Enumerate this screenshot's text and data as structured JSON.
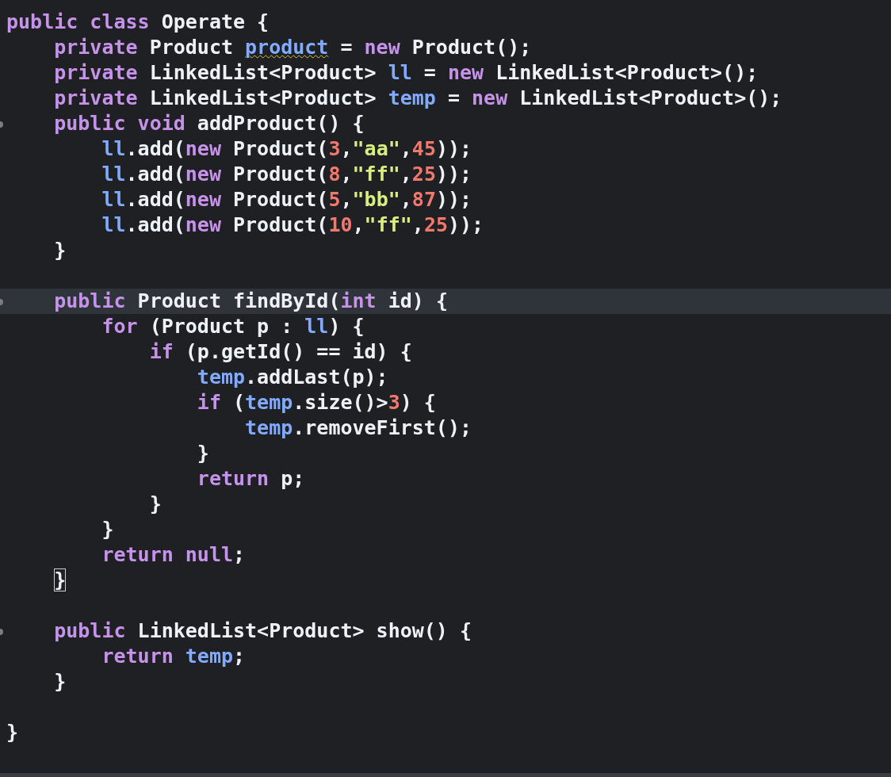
{
  "editor": {
    "lines": [
      {
        "foldable": false,
        "current": false,
        "tokens": [
          {
            "kind": "keyword",
            "text": "public"
          },
          {
            "kind": "keyword",
            "text": " class"
          },
          {
            "kind": "plain",
            "text": " Operate {"
          }
        ]
      },
      {
        "foldable": false,
        "current": false,
        "tokens": [
          {
            "kind": "keyword",
            "text": "    private"
          },
          {
            "kind": "plain",
            "text": " Product "
          },
          {
            "kind": "field_warned",
            "text": "product"
          },
          {
            "kind": "plain",
            "text": " = "
          },
          {
            "kind": "keyword",
            "text": "new"
          },
          {
            "kind": "plain",
            "text": " Product();"
          }
        ]
      },
      {
        "foldable": false,
        "current": false,
        "tokens": [
          {
            "kind": "keyword",
            "text": "    private"
          },
          {
            "kind": "plain",
            "text": " LinkedList<Product> "
          },
          {
            "kind": "field",
            "text": "ll"
          },
          {
            "kind": "plain",
            "text": " = "
          },
          {
            "kind": "keyword",
            "text": "new"
          },
          {
            "kind": "plain",
            "text": " LinkedList<Product>();"
          }
        ]
      },
      {
        "foldable": false,
        "current": false,
        "tokens": [
          {
            "kind": "keyword",
            "text": "    private"
          },
          {
            "kind": "plain",
            "text": " LinkedList<Product> "
          },
          {
            "kind": "field",
            "text": "temp"
          },
          {
            "kind": "plain",
            "text": " = "
          },
          {
            "kind": "keyword",
            "text": "new"
          },
          {
            "kind": "plain",
            "text": " LinkedList<Product>();"
          }
        ]
      },
      {
        "foldable": true,
        "current": false,
        "tokens": [
          {
            "kind": "keyword",
            "text": "    public"
          },
          {
            "kind": "keyword",
            "text": " void"
          },
          {
            "kind": "plain",
            "text": " addProduct() {"
          }
        ]
      },
      {
        "foldable": false,
        "current": false,
        "tokens": [
          {
            "kind": "field",
            "text": "        ll"
          },
          {
            "kind": "plain",
            "text": ".add("
          },
          {
            "kind": "keyword",
            "text": "new"
          },
          {
            "kind": "plain",
            "text": " Product("
          },
          {
            "kind": "number",
            "text": "3"
          },
          {
            "kind": "plain",
            "text": ","
          },
          {
            "kind": "string",
            "text": "\"aa\""
          },
          {
            "kind": "plain",
            "text": ","
          },
          {
            "kind": "number",
            "text": "45"
          },
          {
            "kind": "plain",
            "text": "));"
          }
        ]
      },
      {
        "foldable": false,
        "current": false,
        "tokens": [
          {
            "kind": "field",
            "text": "        ll"
          },
          {
            "kind": "plain",
            "text": ".add("
          },
          {
            "kind": "keyword",
            "text": "new"
          },
          {
            "kind": "plain",
            "text": " Product("
          },
          {
            "kind": "number",
            "text": "8"
          },
          {
            "kind": "plain",
            "text": ","
          },
          {
            "kind": "string",
            "text": "\"ff\""
          },
          {
            "kind": "plain",
            "text": ","
          },
          {
            "kind": "number",
            "text": "25"
          },
          {
            "kind": "plain",
            "text": "));"
          }
        ]
      },
      {
        "foldable": false,
        "current": false,
        "tokens": [
          {
            "kind": "field",
            "text": "        ll"
          },
          {
            "kind": "plain",
            "text": ".add("
          },
          {
            "kind": "keyword",
            "text": "new"
          },
          {
            "kind": "plain",
            "text": " Product("
          },
          {
            "kind": "number",
            "text": "5"
          },
          {
            "kind": "plain",
            "text": ","
          },
          {
            "kind": "string",
            "text": "\"bb\""
          },
          {
            "kind": "plain",
            "text": ","
          },
          {
            "kind": "number",
            "text": "87"
          },
          {
            "kind": "plain",
            "text": "));"
          }
        ]
      },
      {
        "foldable": false,
        "current": false,
        "tokens": [
          {
            "kind": "field",
            "text": "        ll"
          },
          {
            "kind": "plain",
            "text": ".add("
          },
          {
            "kind": "keyword",
            "text": "new"
          },
          {
            "kind": "plain",
            "text": " Product("
          },
          {
            "kind": "number",
            "text": "10"
          },
          {
            "kind": "plain",
            "text": ","
          },
          {
            "kind": "string",
            "text": "\"ff\""
          },
          {
            "kind": "plain",
            "text": ","
          },
          {
            "kind": "number",
            "text": "25"
          },
          {
            "kind": "plain",
            "text": "));"
          }
        ]
      },
      {
        "foldable": false,
        "current": false,
        "tokens": [
          {
            "kind": "plain",
            "text": "    }"
          }
        ]
      },
      {
        "foldable": false,
        "current": false
      },
      {
        "foldable": true,
        "current": true,
        "tokens": [
          {
            "kind": "keyword",
            "text": "    public"
          },
          {
            "kind": "plain",
            "text": " Product findById("
          },
          {
            "kind": "keyword",
            "text": "int"
          },
          {
            "kind": "plain",
            "text": " id) {"
          }
        ]
      },
      {
        "foldable": false,
        "current": false,
        "tokens": [
          {
            "kind": "keyword",
            "text": "        for"
          },
          {
            "kind": "plain",
            "text": " (Product p : "
          },
          {
            "kind": "field",
            "text": "ll"
          },
          {
            "kind": "plain",
            "text": ") {"
          }
        ]
      },
      {
        "foldable": false,
        "current": false,
        "tokens": [
          {
            "kind": "keyword",
            "text": "            if"
          },
          {
            "kind": "plain",
            "text": " (p.getId() == id) {"
          }
        ]
      },
      {
        "foldable": false,
        "current": false,
        "tokens": [
          {
            "kind": "field",
            "text": "                temp"
          },
          {
            "kind": "plain",
            "text": ".addLast(p);"
          }
        ]
      },
      {
        "foldable": false,
        "current": false,
        "tokens": [
          {
            "kind": "keyword",
            "text": "                if"
          },
          {
            "kind": "plain",
            "text": " ("
          },
          {
            "kind": "field",
            "text": "temp"
          },
          {
            "kind": "plain",
            "text": ".size()>"
          },
          {
            "kind": "number",
            "text": "3"
          },
          {
            "kind": "plain",
            "text": ") {"
          }
        ]
      },
      {
        "foldable": false,
        "current": false,
        "tokens": [
          {
            "kind": "field",
            "text": "                    temp"
          },
          {
            "kind": "plain",
            "text": ".removeFirst();"
          }
        ]
      },
      {
        "foldable": false,
        "current": false,
        "tokens": [
          {
            "kind": "plain",
            "text": "                }"
          }
        ]
      },
      {
        "foldable": false,
        "current": false,
        "tokens": [
          {
            "kind": "keyword",
            "text": "                return"
          },
          {
            "kind": "plain",
            "text": " p;"
          }
        ]
      },
      {
        "foldable": false,
        "current": false,
        "tokens": [
          {
            "kind": "plain",
            "text": "            }"
          }
        ]
      },
      {
        "foldable": false,
        "current": false,
        "tokens": [
          {
            "kind": "plain",
            "text": "        }"
          }
        ]
      },
      {
        "foldable": false,
        "current": false,
        "tokens": [
          {
            "kind": "keyword",
            "text": "        return"
          },
          {
            "kind": "keyword",
            "text": " null"
          },
          {
            "kind": "plain",
            "text": ";"
          }
        ]
      },
      {
        "foldable": false,
        "current": false,
        "tokens": [
          {
            "kind": "matched_bracket",
            "text": "    }"
          }
        ]
      },
      {
        "foldable": false,
        "current": false
      },
      {
        "foldable": true,
        "current": false,
        "tokens": [
          {
            "kind": "keyword",
            "text": "    public"
          },
          {
            "kind": "plain",
            "text": " LinkedList<Product> show() {"
          }
        ]
      },
      {
        "foldable": false,
        "current": false,
        "tokens": [
          {
            "kind": "keyword",
            "text": "        return"
          },
          {
            "kind": "field",
            "text": " temp"
          },
          {
            "kind": "plain",
            "text": ";"
          }
        ]
      },
      {
        "foldable": false,
        "current": false,
        "tokens": [
          {
            "kind": "plain",
            "text": "    }"
          }
        ]
      },
      {
        "foldable": false,
        "current": false
      },
      {
        "foldable": false,
        "current": false,
        "tokens": [
          {
            "kind": "plain",
            "text": "}"
          }
        ]
      }
    ]
  }
}
